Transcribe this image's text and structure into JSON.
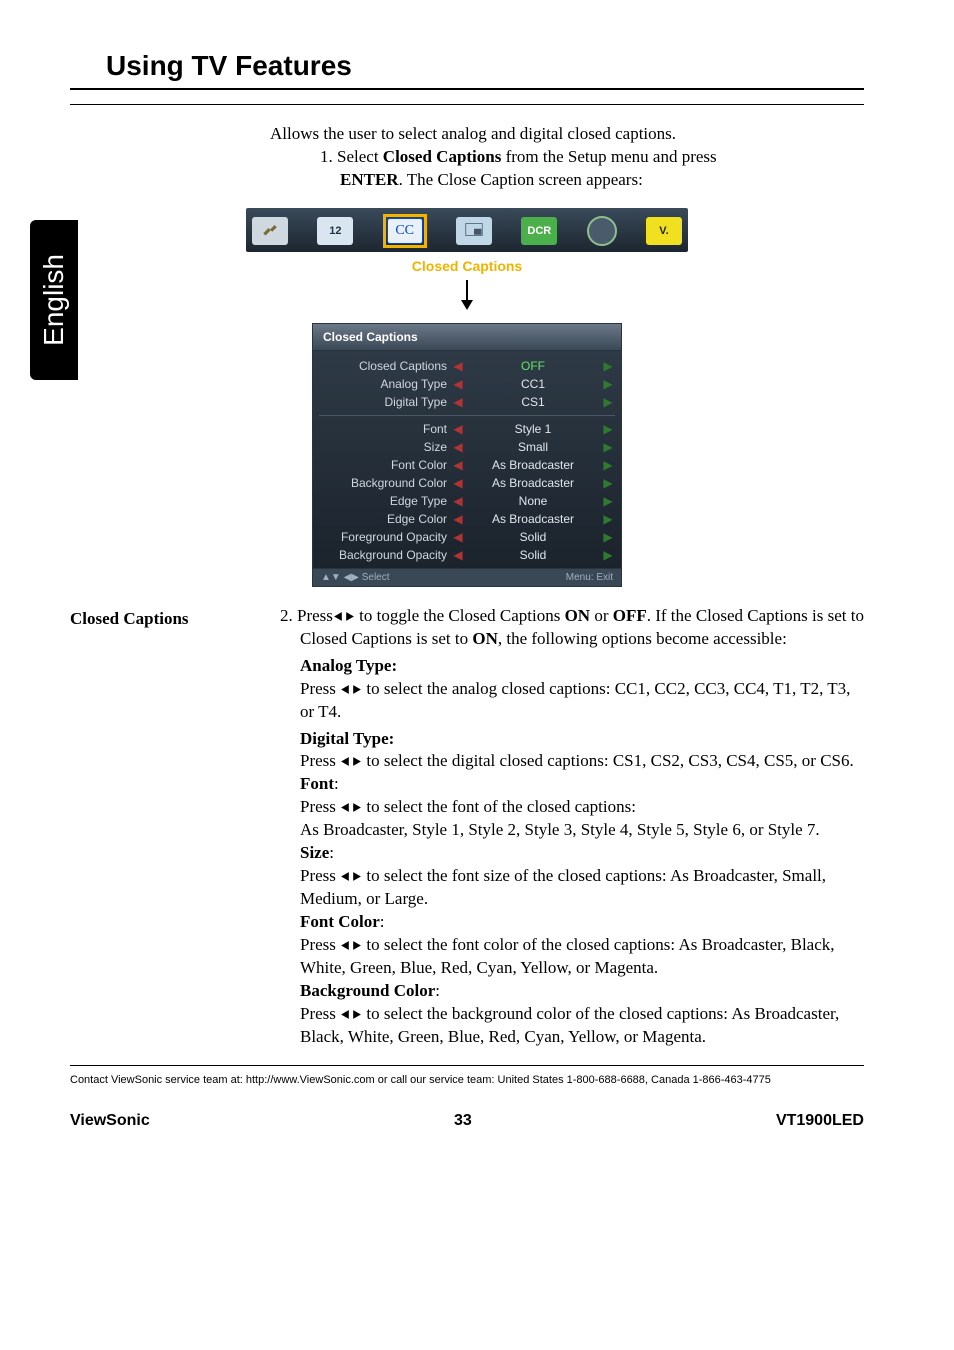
{
  "side_tab": "English",
  "section_title": "Using TV Features",
  "intro": "Allows the user to select analog and digital closed captions.",
  "step1_prefix": "1. Select ",
  "step1_bold1": "Closed Captions",
  "step1_mid": " from the Setup menu and press ",
  "step1_bold2": "ENTER",
  "step1_suffix": ". The Close Caption screen appears:",
  "menu_strip": {
    "label": "Closed Captions",
    "icons": {
      "i12": "12",
      "cc": "CC",
      "dcr": "DCR",
      "v": "V."
    }
  },
  "cc_panel": {
    "title": "Closed Captions",
    "rows1": [
      {
        "label": "Closed Captions",
        "value": "OFF",
        "hl": true
      },
      {
        "label": "Analog Type",
        "value": "CC1"
      },
      {
        "label": "Digital Type",
        "value": "CS1"
      }
    ],
    "rows2": [
      {
        "label": "Font",
        "value": "Style 1"
      },
      {
        "label": "Size",
        "value": "Small"
      },
      {
        "label": "Font Color",
        "value": "As Broadcaster"
      },
      {
        "label": "Background Color",
        "value": "As Broadcaster"
      },
      {
        "label": "Edge Type",
        "value": "None"
      },
      {
        "label": "Edge Color",
        "value": "As Broadcaster"
      },
      {
        "label": "Foreground Opacity",
        "value": "Solid"
      },
      {
        "label": "Background Opacity",
        "value": "Solid"
      }
    ],
    "foot_left": "▲▼ ◀▶  Select",
    "foot_right": "Menu: Exit"
  },
  "left_heading": "Closed Captions",
  "step2": {
    "pre": "2. Press ",
    "mid1": " to toggle the Closed Captions ",
    "b_on": "ON",
    "or": " or ",
    "b_off": "OFF",
    "mid2": ". If the Closed Captions is set to ",
    "b_on2": "ON",
    "tail": ", the following options become accessible:"
  },
  "opts": {
    "analog_head": "Analog Type:",
    "analog_pre": "Press ",
    "analog_body": " to select the analog closed captions: CC1, CC2, CC3, CC4, T1, T2, T3, or T4.",
    "digital_head": "Digital Type:",
    "digital_pre": "Press ",
    "digital_body": " to select the digital closed captions: CS1, CS2, CS3, CS4, CS5, or CS6.",
    "font_head": "Font",
    "font_colon": ":",
    "font_pre": "Press ",
    "font_body": " to select the font of the closed captions:",
    "font_body2": "As Broadcaster, Style 1, Style 2, Style 3, Style 4, Style 5, Style 6, or Style 7.",
    "size_head": "Size",
    "size_colon": ":",
    "size_pre": "Press ",
    "size_body": " to select the font size of the closed captions: As Broadcaster, Small, Medium, or Large.",
    "fc_head": "Font Color",
    "fc_colon": ":",
    "fc_pre": "Press ",
    "fc_body": " to select the font color of the closed captions: As Broadcaster, Black, White, Green, Blue, Red, Cyan, Yellow, or Magenta.",
    "bc_head": "Background Color",
    "bc_colon": ":",
    "bc_pre": "Press ",
    "bc_body": " to select the background color of the closed captions: As Broadcaster, Black, White, Green, Blue, Red, Cyan, Yellow, or Magenta."
  },
  "contact": "Contact ViewSonic service team at: http://www.ViewSonic.com or call our service team: United States 1-800-688-6688, Canada 1-866-463-4775",
  "footer": {
    "left": "ViewSonic",
    "center": "33",
    "right": "VT1900LED"
  }
}
